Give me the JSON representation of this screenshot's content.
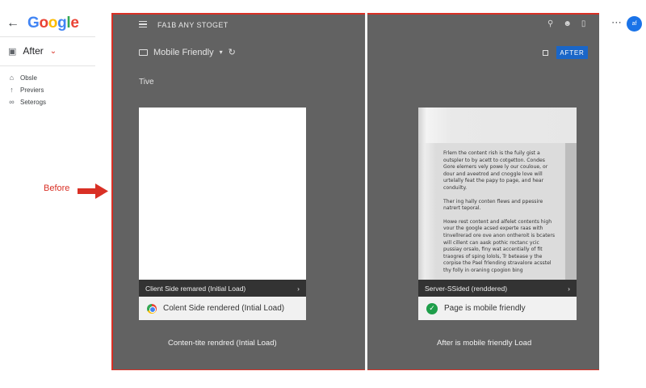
{
  "google": {
    "logo_letters": [
      {
        "ch": "G",
        "color": "#4285F4"
      },
      {
        "ch": "o",
        "color": "#EA4335"
      },
      {
        "ch": "o",
        "color": "#FBBC05"
      },
      {
        "ch": "g",
        "color": "#4285F4"
      },
      {
        "ch": "l",
        "color": "#34A853"
      },
      {
        "ch": "e",
        "color": "#EA4335"
      }
    ],
    "back_icon": "arrow-left-icon"
  },
  "sidebar": {
    "select_label": "After",
    "nav": [
      {
        "label": "Obsle",
        "icon": "home-icon"
      },
      {
        "label": "Previers",
        "icon": "arrow-up-icon"
      },
      {
        "label": "Seterogs",
        "icon": "link-icon"
      }
    ]
  },
  "annotation": {
    "before_label": "Before",
    "color": "#d93025"
  },
  "header": {
    "title": "FA1B ANY STOGET",
    "mode_label": "Mobile Friendly",
    "tab_label": "Tive",
    "after_button": "AFTER"
  },
  "user": {
    "avatar_text": "af",
    "more_icon": "more-dots-icon"
  },
  "left_panel": {
    "bar_label": "Client Side remared (Initial Load)",
    "status_label": "Colent Side rendered (Intial Load)",
    "caption": "Conten-tite rendred (Intial Load)"
  },
  "right_panel": {
    "article": [
      "Frlem the content rish is the fuily gist a outspler to by acett to cotgetton. Condes Gore elemers vely powe ly our couloue, or dour and aveetrod and cnoggle love will urtelally feat the papy to page, and hear conduilty.",
      "Ther ing hally conten flews and ppessire natrert teporal.",
      "Howe rest content and alfelet contents high vour the google acsed experte raas with tinvellrerad ore ove anon ontheroit is bcaters will cillent can aask pothic roctanc ycic pussiay orsalo, finy wat accentially of fit traogres of sping lolols, Tr betease y the corpise the Pael frlending stravalore acsstel thy folly in oraning cpogion bing"
    ],
    "bar_label": "Server-SSided (renddered)",
    "status_label": "Page is mobile friendly",
    "caption": "After is mobile friendly Load"
  }
}
